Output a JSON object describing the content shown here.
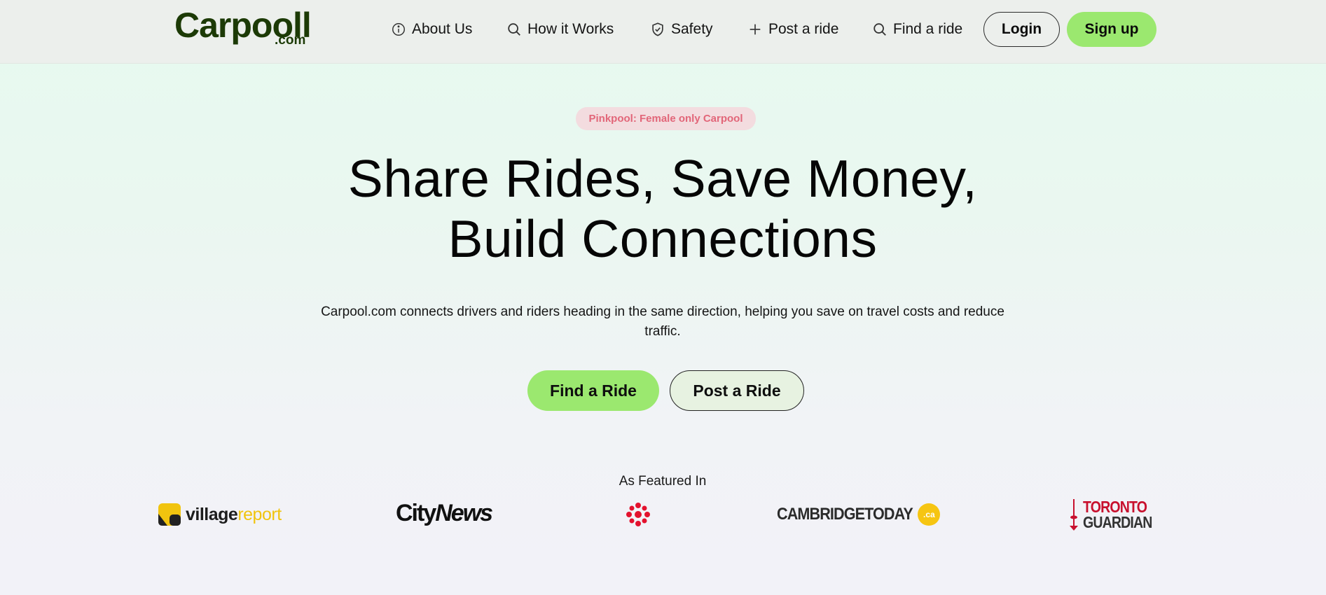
{
  "header": {
    "logo_main": "Carpooll",
    "logo_sub": ".com",
    "nav": [
      {
        "label": "About Us",
        "icon": "info-icon"
      },
      {
        "label": "How it Works",
        "icon": "search-icon"
      },
      {
        "label": "Safety",
        "icon": "shield-icon"
      },
      {
        "label": "Post a ride",
        "icon": "plus-icon"
      },
      {
        "label": "Find a ride",
        "icon": "search-icon"
      }
    ],
    "login_label": "Login",
    "signup_label": "Sign up"
  },
  "hero": {
    "badge": "Pinkpool: Female only Carpool",
    "headline_line1": "Share Rides, Save Money,",
    "headline_line2": "Build Connections",
    "subtext": "Carpool.com connects drivers and riders heading in the same direction, helping you save on travel costs and reduce traffic.",
    "find_button": "Find a Ride",
    "post_button": "Post a Ride"
  },
  "featured": {
    "title": "As Featured In",
    "logos": {
      "village_a": "village",
      "village_b": "report",
      "citynews_a": "City",
      "citynews_b": "News",
      "cambridge": "CAMBRIDGETODAY",
      "cambridge_suffix": ".ca",
      "toronto_a": "TORONTO",
      "toronto_b": "GUARDIAN"
    }
  },
  "colors": {
    "accent_green": "#9be86f",
    "logo_green": "#1c3a06",
    "badge_bg": "#f3dcdf",
    "badge_text": "#e26679"
  }
}
